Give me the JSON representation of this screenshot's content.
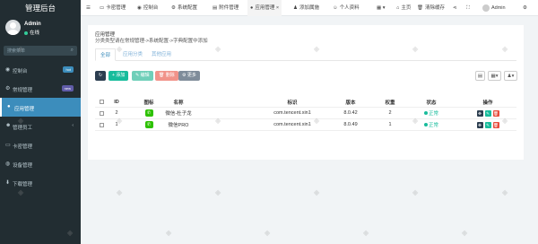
{
  "brand": "管理后台",
  "user": {
    "name": "Admin",
    "status": "在线"
  },
  "search": {
    "placeholder": "搜索菜单"
  },
  "menu": [
    {
      "icon": "dashboard-icon",
      "glyph": "◉",
      "label": "控制台",
      "badge": "hot",
      "badge_color": "#3c8dbc"
    },
    {
      "icon": "gear-icon",
      "glyph": "⚙",
      "label": "常规管理",
      "badge": "new",
      "badge_color": "#605ca8"
    },
    {
      "icon": "app-icon",
      "glyph": "●",
      "label": "应用管理",
      "active": true
    },
    {
      "icon": "users-icon",
      "glyph": "☻",
      "label": "管理员工",
      "arrow": "‹"
    },
    {
      "icon": "card-icon",
      "glyph": "▭",
      "label": "卡密管理"
    },
    {
      "icon": "device-icon",
      "glyph": "◍",
      "label": "设备管理"
    },
    {
      "icon": "download-icon",
      "glyph": "⬇",
      "label": "下载管理"
    }
  ],
  "topbar": {
    "tabs": [
      {
        "icon": "card-icon",
        "glyph": "▭",
        "label": "卡密管理"
      },
      {
        "icon": "dashboard-icon",
        "glyph": "◉",
        "label": "控制台"
      },
      {
        "icon": "gear-icon",
        "glyph": "⚙",
        "label": "系统配置"
      },
      {
        "icon": "file-icon",
        "glyph": "▤",
        "label": "附件管理"
      },
      {
        "icon": "app-icon",
        "glyph": "●",
        "label": "应用管理",
        "active": true
      },
      {
        "icon": "add-user-icon",
        "glyph": "♟",
        "label": "添加属施"
      },
      {
        "icon": "profile-icon",
        "glyph": "☺",
        "label": "个人资料"
      }
    ],
    "right": {
      "menu_icon": "▦",
      "home": "主页",
      "clear_cache": "清除缓存",
      "admin": "Admin"
    }
  },
  "panel": {
    "title": "应用管理",
    "subtitle": "分类类型请在常规管理->系统配置->字典配置中添加",
    "tabs": [
      "全部",
      "应用分类",
      "其他应用"
    ],
    "buttons": {
      "add": "+ 添加",
      "edit": "✎ 编辑",
      "delete": "🗑 删除",
      "more": "⚙ 更多"
    },
    "table": {
      "headers": [
        "ID",
        "图标",
        "名称",
        "标识",
        "版本",
        "权重",
        "状态",
        "操作"
      ],
      "rows": [
        {
          "id": "2",
          "name": "微信-杜子龙",
          "package": "com.tencent.xin1",
          "version": "8.0.42",
          "weight": "2",
          "status": "正常"
        },
        {
          "id": "1",
          "name": "微信PRO",
          "package": "com.tencent.xin1",
          "version": "8.0.49",
          "weight": "1",
          "status": "正常"
        }
      ]
    }
  },
  "colors": {
    "sidebar": "#222d32",
    "accent": "#3c8dbc",
    "success": "#18bc9c",
    "danger": "#e74c3c",
    "wechat": "#2dc100"
  }
}
